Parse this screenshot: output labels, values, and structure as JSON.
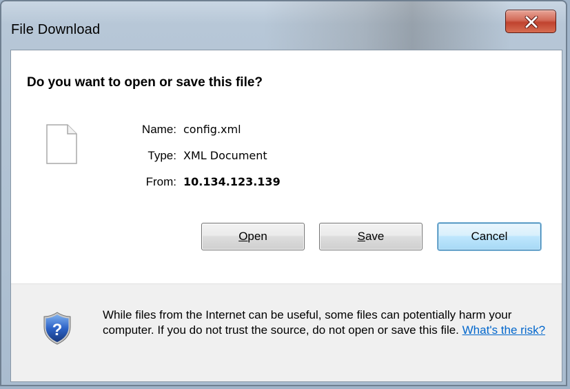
{
  "window": {
    "title": "File Download",
    "close_glyph": "×"
  },
  "dialog": {
    "heading": "Do you want to open or save this file?",
    "file": {
      "icon": "document-icon",
      "name_label": "Name:",
      "name_value": "config.xml",
      "type_label": "Type:",
      "type_value": "XML Document",
      "from_label": "From:",
      "from_value": "10.134.123.139"
    },
    "buttons": {
      "open": {
        "mnemonic": "O",
        "rest": "pen"
      },
      "save": {
        "mnemonic": "S",
        "rest": "ave"
      },
      "cancel": "Cancel"
    },
    "footer": {
      "icon": "security-shield-question-icon",
      "warning_text": "While files from the Internet can be useful, some files can potentially harm your computer. If you do not trust the source, do not open or save this file.",
      "risk_link": "What's the risk?"
    }
  },
  "colors": {
    "link": "#0066cc",
    "close_button": "#c0432f",
    "footer_background": "#f0f0f0"
  }
}
